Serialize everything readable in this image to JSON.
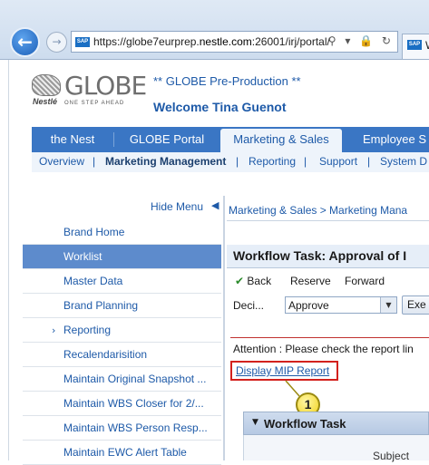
{
  "browser": {
    "url_prefix": "https://globe7eurprep.",
    "url_domain": "nestle.com",
    "url_suffix": ":26001/irj/portal/",
    "addr_icons": "⚲ ▾ 🔒 ↻",
    "tab_title": "W",
    "favicon_text": "SAP"
  },
  "header": {
    "logo_brand": "Nestlé",
    "logo_name": "GLOBE",
    "logo_tagline": "ONE STEP AHEAD",
    "environment": "** GLOBE Pre-Production **",
    "welcome": "Welcome Tina Guenot"
  },
  "topnav": {
    "items": [
      "the Nest",
      "GLOBE Portal",
      "Marketing & Sales",
      "Employee S"
    ]
  },
  "subnav": {
    "items": [
      "Overview",
      "Marketing Management",
      "Reporting",
      "Support",
      "System D"
    ],
    "separator": "|"
  },
  "menu": {
    "hide_label": "Hide Menu",
    "items": [
      "Brand Home",
      "Worklist",
      "Master Data",
      "Brand Planning",
      "Reporting",
      "Recalendarisition",
      "Maintain Original Snapshot ...",
      "Maintain WBS Closer for 2/...",
      "Maintain WBS Person Resp...",
      "Maintain EWC Alert Table"
    ]
  },
  "content": {
    "breadcrumb": "Marketing & Sales  >  Marketing Mana",
    "title": "Workflow Task: Approval of I",
    "toolbar": {
      "back": "Back",
      "reserve": "Reserve",
      "forward": "Forward"
    },
    "decision_label": "Deci...",
    "decision_value": "Approve",
    "execute_label": "Exe",
    "attention": "Attention : Please check the report lin",
    "mip_link": "Display MIP Report",
    "callout_number": "1",
    "panel_title": "Workflow Task",
    "subject_label": "Subject"
  },
  "colors": {
    "nav_blue": "#3a76c4",
    "link_blue": "#1e5aa8",
    "highlight_red": "#d3211d",
    "callout_yellow": "#f1d21c"
  }
}
